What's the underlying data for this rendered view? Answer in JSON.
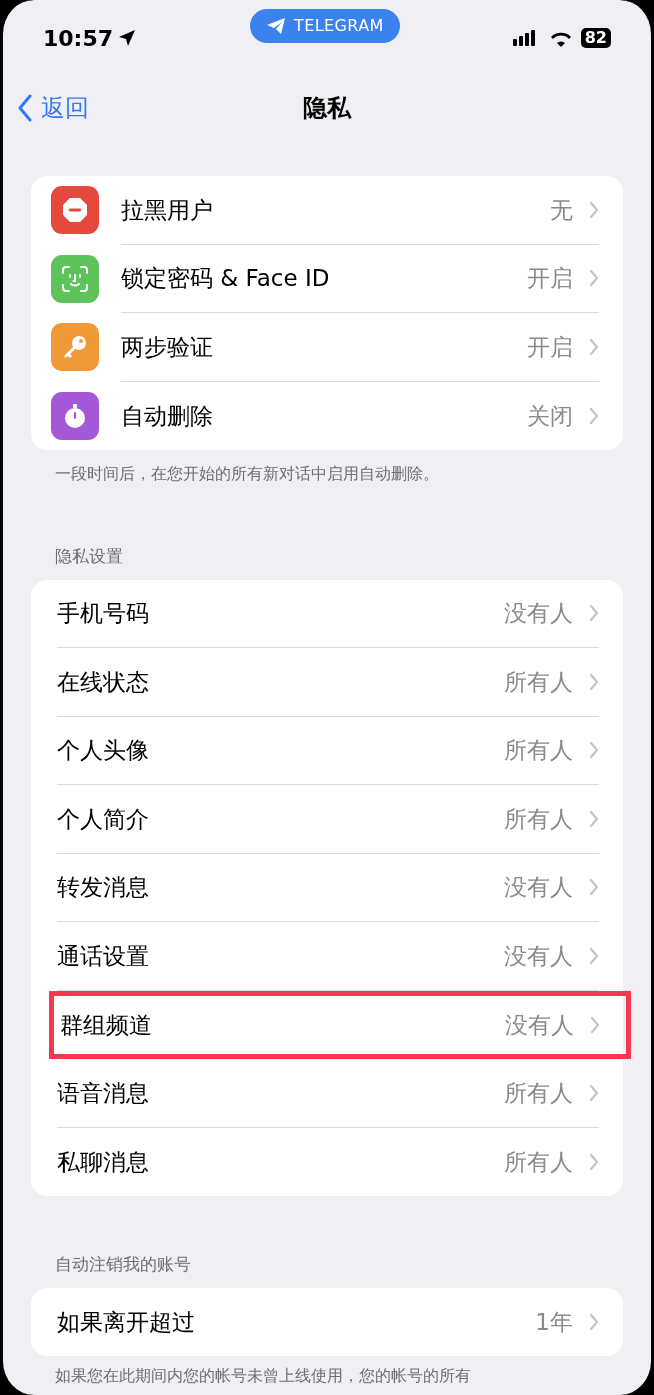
{
  "status_bar": {
    "time": "10:57",
    "app_pill": "TELEGRAM",
    "battery": "82"
  },
  "nav": {
    "back": "返回",
    "title": "隐私"
  },
  "security": {
    "items": [
      {
        "kind": "blocked",
        "label": "拉黑用户",
        "value": "无",
        "color": "#e5483d"
      },
      {
        "kind": "faceid",
        "label": "锁定密码 & Face ID",
        "value": "开启",
        "color": "#5ec35b"
      },
      {
        "kind": "key",
        "label": "两步验证",
        "value": "开启",
        "color": "#f09a37"
      },
      {
        "kind": "timer",
        "label": "自动删除",
        "value": "关闭",
        "color": "#a457d6"
      }
    ],
    "footer": "一段时间后，在您开始的所有新对话中启用自动删除。"
  },
  "privacy": {
    "header": "隐私设置",
    "items": [
      {
        "label": "手机号码",
        "value": "没有人",
        "highlighted": false
      },
      {
        "label": "在线状态",
        "value": "所有人",
        "highlighted": false
      },
      {
        "label": "个人头像",
        "value": "所有人",
        "highlighted": false
      },
      {
        "label": "个人简介",
        "value": "所有人",
        "highlighted": false
      },
      {
        "label": "转发消息",
        "value": "没有人",
        "highlighted": false
      },
      {
        "label": "通话设置",
        "value": "没有人",
        "highlighted": false
      },
      {
        "label": "群组频道",
        "value": "没有人",
        "highlighted": true
      },
      {
        "label": "语音消息",
        "value": "所有人",
        "highlighted": false
      },
      {
        "label": "私聊消息",
        "value": "所有人",
        "highlighted": false
      }
    ]
  },
  "account": {
    "header": "自动注销我的账号",
    "items": [
      {
        "label": "如果离开超过",
        "value": "1年"
      }
    ],
    "footer": "如果您在此期间内您的帐号未曾上线使用，您的帐号的所有"
  }
}
